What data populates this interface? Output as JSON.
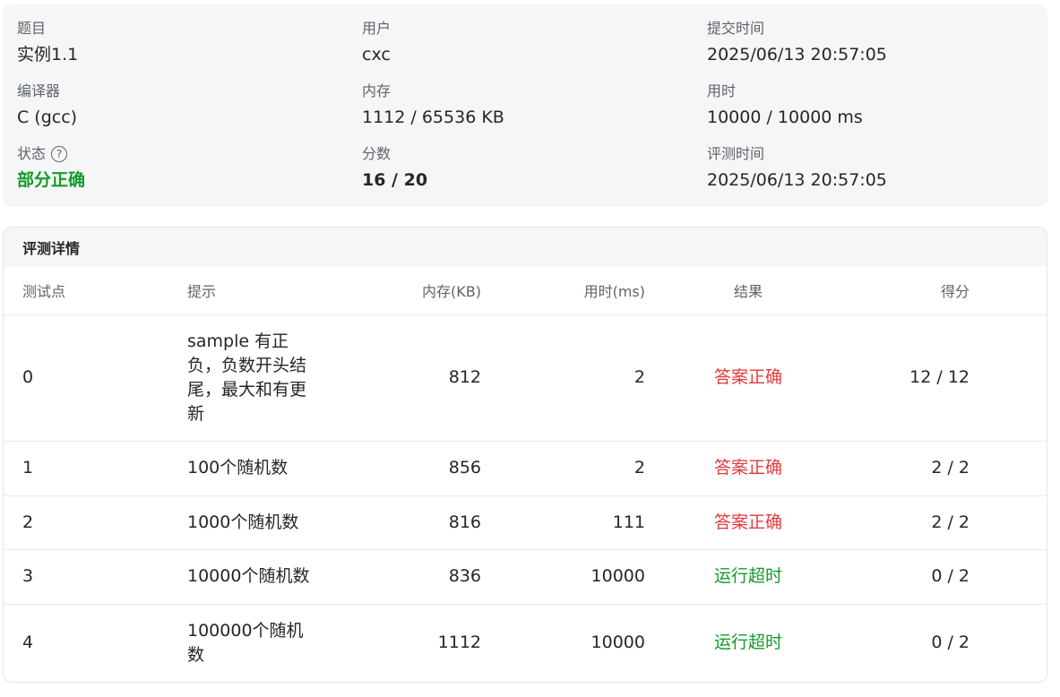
{
  "summary": {
    "problem_label": "题目",
    "problem_value": "实例1.1",
    "user_label": "用户",
    "user_value": "cxc",
    "submit_time_label": "提交时间",
    "submit_time_value": "2025/06/13 20:57:05",
    "compiler_label": "编译器",
    "compiler_value": "C (gcc)",
    "memory_label": "内存",
    "memory_value": "1112 / 65536 KB",
    "time_label": "用时",
    "time_value": "10000 / 10000 ms",
    "status_label": "状态",
    "status_help_icon": "question-circle-icon",
    "status_value": "部分正确",
    "score_label": "分数",
    "score_value": "16 / 20",
    "judge_time_label": "评测时间",
    "judge_time_value": "2025/06/13 20:57:05"
  },
  "details": {
    "title": "评测详情",
    "columns": [
      "测试点",
      "提示",
      "内存(KB)",
      "用时(ms)",
      "结果",
      "得分"
    ],
    "rows": [
      {
        "id": "0",
        "hint": "sample 有正负，负数开头结尾，最大和有更新",
        "memory": "812",
        "time": "2",
        "result": "答案正确",
        "score": "12 / 12"
      },
      {
        "id": "1",
        "hint": "100个随机数",
        "memory": "856",
        "time": "2",
        "result": "答案正确",
        "score": "2 / 2"
      },
      {
        "id": "2",
        "hint": "1000个随机数",
        "memory": "816",
        "time": "111",
        "result": "答案正确",
        "score": "2 / 2"
      },
      {
        "id": "3",
        "hint": "10000个随机数",
        "memory": "836",
        "time": "10000",
        "result": "运行超时",
        "score": "0 / 2"
      },
      {
        "id": "4",
        "hint": "100000个随机数",
        "memory": "1112",
        "time": "10000",
        "result": "运行超时",
        "score": "0 / 2"
      }
    ]
  },
  "colors": {
    "accepted": "#e23b3b",
    "time_limit_exceeded": "#159a2d",
    "partial": "#159a2d"
  }
}
